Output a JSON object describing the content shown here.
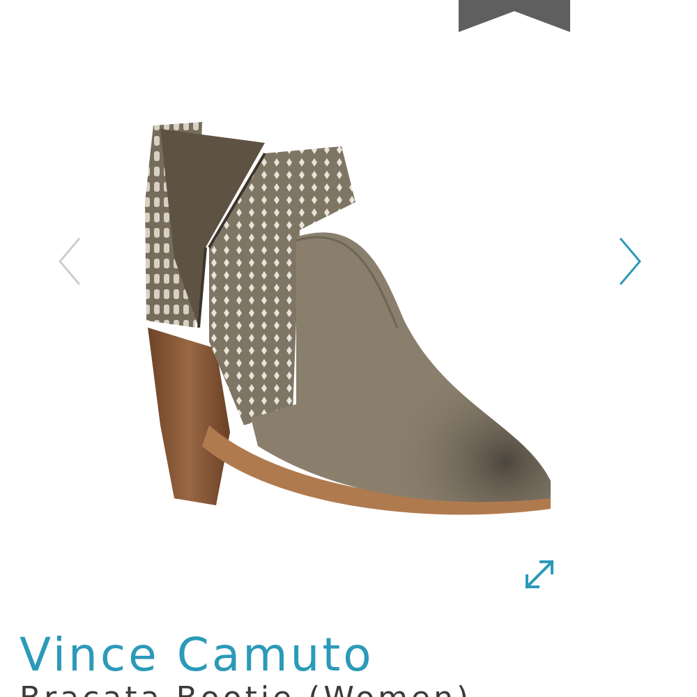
{
  "colors": {
    "accent": "#2b9ab8",
    "text_dark": "#3a3a3a",
    "ribbon": "#5f5f5f",
    "chevron_prev": "#c9cfd3",
    "chevron_next": "#2b9ab8",
    "suede": "#8a7f6d",
    "heel_wood": "#8a5a38",
    "sole": "#b07a4f"
  },
  "header": {
    "bookmark_icon": "bookmark-ribbon-icon"
  },
  "gallery": {
    "image_alt": "Vince Camuto Bracata Bootie (Women)",
    "prev_icon": "chevron-left-icon",
    "next_icon": "chevron-right-icon",
    "expand_icon": "expand-icon"
  },
  "product": {
    "brand": "Vince Camuto",
    "name": "Bracata Bootie (Women)"
  }
}
